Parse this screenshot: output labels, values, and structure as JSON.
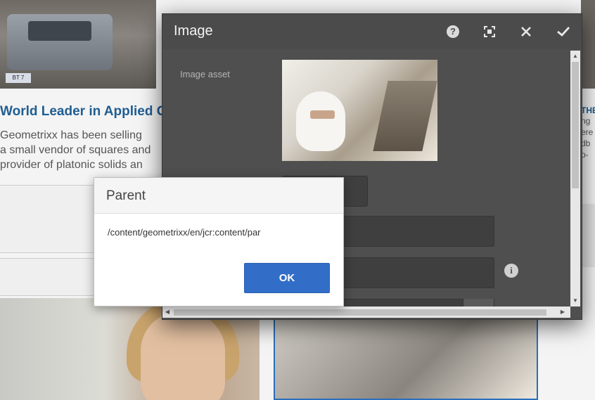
{
  "background_page": {
    "plate_text": "BT 7",
    "headline": "World Leader in Applied G",
    "paragraph_lines": [
      "Geometrixx has been selling",
      "a small vendor of squares and",
      "provider of platonic solids an"
    ],
    "right_headline": "THE",
    "right_paragraph_lines": [
      "ng",
      "ere",
      "db",
      "o-"
    ]
  },
  "dialog": {
    "title": "Image",
    "help_icon": "help-icon",
    "fullscreen_icon": "fullscreen-icon",
    "close_icon": "close-icon",
    "done_icon": "checkmark-icon",
    "image_asset_label": "Image asset",
    "info_icon_glyph": "i"
  },
  "alert": {
    "title": "Parent",
    "message": "/content/geometrixx/en/jcr:content/par",
    "ok_label": "OK"
  },
  "colors": {
    "dialog_bg": "#4f4f4f",
    "accent": "#326ec8",
    "link_blue": "#1f5d92"
  }
}
